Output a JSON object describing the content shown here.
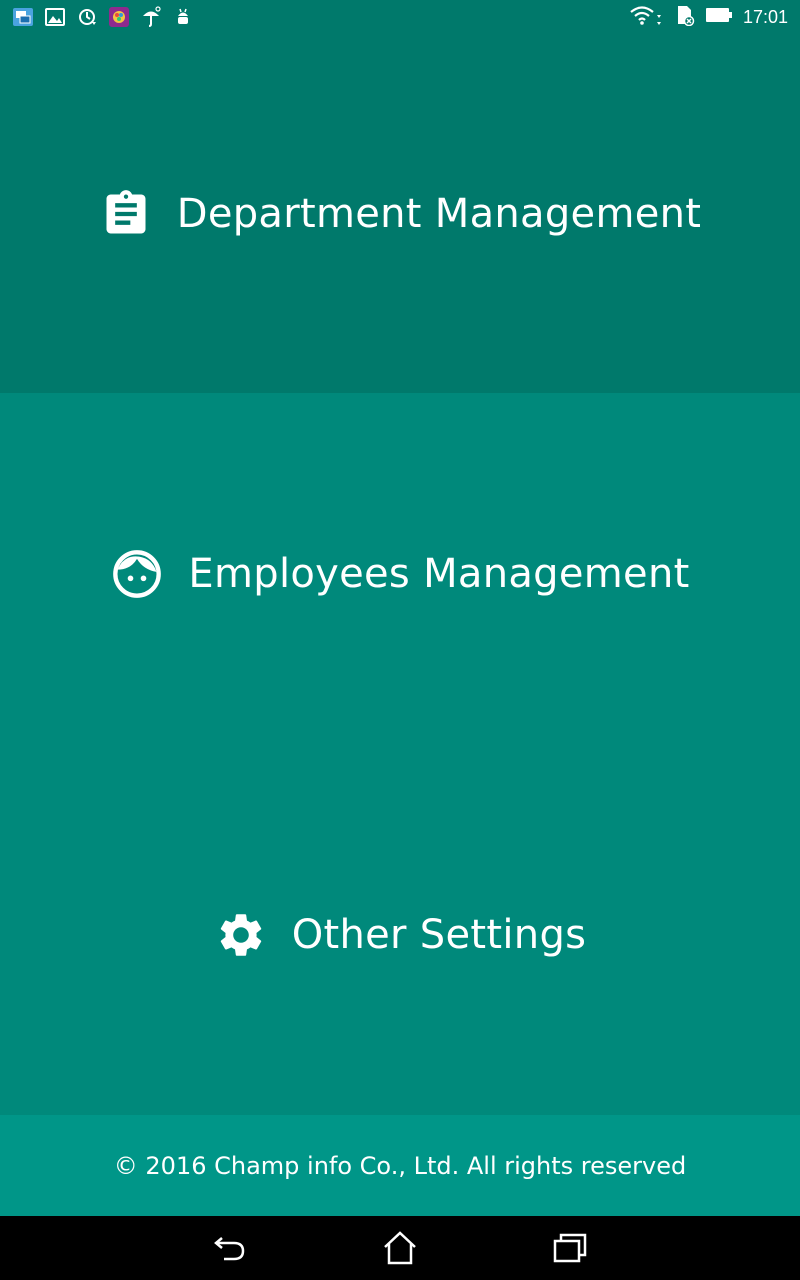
{
  "status_bar": {
    "time": "17:01",
    "left_icons": [
      "screenshot-icon",
      "gallery-icon",
      "sync-icon",
      "app-color-icon",
      "umbrella-icon",
      "android-icon"
    ],
    "right_icons": [
      "wifi-icon",
      "sd-card-icon",
      "battery-icon"
    ]
  },
  "menu": {
    "items": [
      {
        "label": "Department Management",
        "icon": "clipboard-icon"
      },
      {
        "label": "Employees Management",
        "icon": "face-icon"
      },
      {
        "label": "Other Settings",
        "icon": "gear-icon"
      }
    ]
  },
  "footer": {
    "text": "© 2016 Champ info Co., Ltd. All rights reserved"
  },
  "nav_bar": {
    "buttons": [
      "back-icon",
      "home-icon",
      "recent-apps-icon"
    ]
  },
  "colors": {
    "panel_dark": "#00796b",
    "panel_mid": "#00897b",
    "footer": "#009688",
    "nav": "#000000",
    "text": "#ffffff"
  }
}
